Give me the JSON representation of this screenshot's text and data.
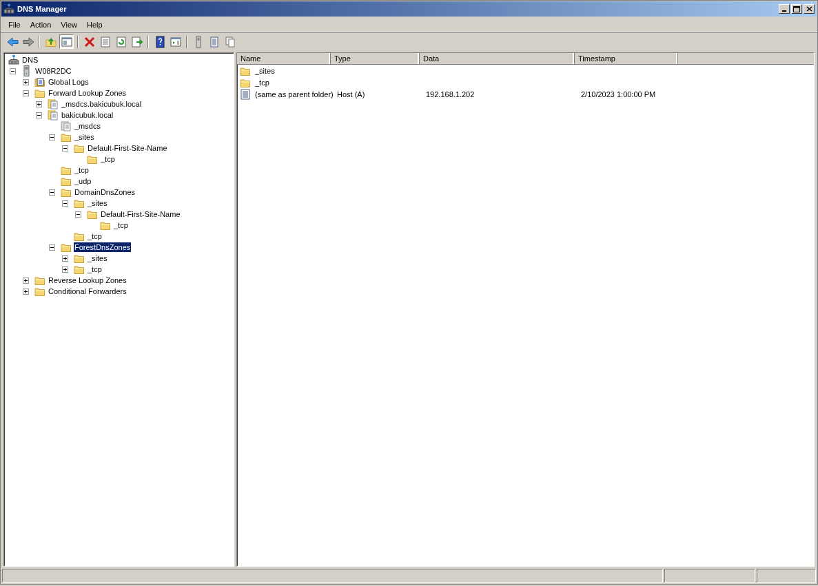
{
  "window": {
    "title": "DNS Manager"
  },
  "menu": [
    "File",
    "Action",
    "View",
    "Help"
  ],
  "toolbar": [
    {
      "kind": "back"
    },
    {
      "kind": "forward"
    },
    {
      "kind": "separator"
    },
    {
      "kind": "up"
    },
    {
      "kind": "tree-toggle",
      "pressed": true
    },
    {
      "kind": "separator"
    },
    {
      "kind": "delete"
    },
    {
      "kind": "properties"
    },
    {
      "kind": "refresh"
    },
    {
      "kind": "export"
    },
    {
      "kind": "separator"
    },
    {
      "kind": "help"
    },
    {
      "kind": "action-pane"
    },
    {
      "kind": "separator"
    },
    {
      "kind": "server"
    },
    {
      "kind": "list"
    },
    {
      "kind": "copy"
    }
  ],
  "tree": [
    {
      "label": "DNS",
      "kind": "dns",
      "selected": false,
      "children": [
        {
          "label": "W08R2DC",
          "kind": "server",
          "expanded": true,
          "selected": false,
          "children": [
            {
              "label": "Global Logs",
              "kind": "logs",
              "expanded": false,
              "selected": false
            },
            {
              "label": "Forward Lookup Zones",
              "kind": "folder",
              "expanded": true,
              "selected": false,
              "children": [
                {
                  "label": "_msdcs.bakicubuk.local",
                  "kind": "zone",
                  "expanded": false,
                  "selected": false
                },
                {
                  "label": "bakicubuk.local",
                  "kind": "zone",
                  "expanded": true,
                  "selected": false,
                  "children": [
                    {
                      "label": "_msdcs",
                      "kind": "delegation",
                      "selected": false
                    },
                    {
                      "label": "_sites",
                      "kind": "folder",
                      "expanded": true,
                      "selected": false,
                      "children": [
                        {
                          "label": "Default-First-Site-Name",
                          "kind": "folder",
                          "expanded": true,
                          "selected": false,
                          "children": [
                            {
                              "label": "_tcp",
                              "kind": "folder",
                              "selected": false
                            }
                          ]
                        }
                      ]
                    },
                    {
                      "label": "_tcp",
                      "kind": "folder",
                      "selected": false
                    },
                    {
                      "label": "_udp",
                      "kind": "folder",
                      "selected": false
                    },
                    {
                      "label": "DomainDnsZones",
                      "kind": "folder",
                      "expanded": true,
                      "selected": false,
                      "children": [
                        {
                          "label": "_sites",
                          "kind": "folder",
                          "expanded": true,
                          "selected": false,
                          "children": [
                            {
                              "label": "Default-First-Site-Name",
                              "kind": "folder",
                              "expanded": true,
                              "selected": false,
                              "children": [
                                {
                                  "label": "_tcp",
                                  "kind": "folder",
                                  "selected": false
                                }
                              ]
                            }
                          ]
                        },
                        {
                          "label": "_tcp",
                          "kind": "folder",
                          "selected": false
                        }
                      ]
                    },
                    {
                      "label": "ForestDnsZones",
                      "kind": "folder",
                      "expanded": true,
                      "selected": true,
                      "children": [
                        {
                          "label": "_sites",
                          "kind": "folder",
                          "expanded": false,
                          "selected": false
                        },
                        {
                          "label": "_tcp",
                          "kind": "folder",
                          "expanded": false,
                          "selected": false
                        }
                      ]
                    }
                  ]
                }
              ]
            },
            {
              "label": "Reverse Lookup Zones",
              "kind": "folder",
              "expanded": false,
              "selected": false
            },
            {
              "label": "Conditional Forwarders",
              "kind": "folder",
              "expanded": false,
              "selected": false
            }
          ]
        }
      ]
    }
  ],
  "list": {
    "columns": [
      "Name",
      "Type",
      "Data",
      "Timestamp"
    ],
    "rows": [
      {
        "kind": "folder",
        "cells": [
          "_sites"
        ]
      },
      {
        "kind": "folder",
        "cells": [
          "_tcp"
        ]
      },
      {
        "kind": "record",
        "cells": [
          "(same as parent folder)",
          "Host (A)",
          "192.168.1.202",
          "2/10/2023 1:00:00 PM"
        ]
      }
    ]
  }
}
